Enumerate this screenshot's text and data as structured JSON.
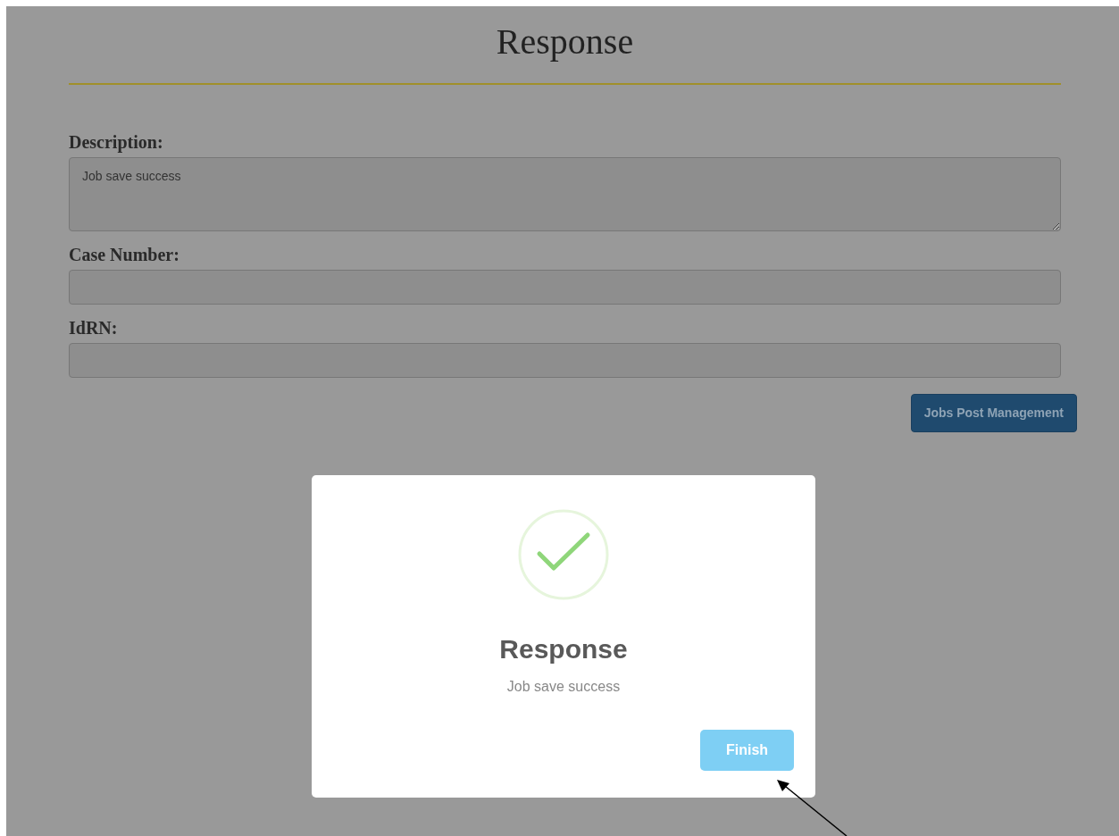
{
  "page": {
    "title": "Response"
  },
  "fields": [
    {
      "label": "Description:",
      "kind": "textarea",
      "value": "Job save success"
    },
    {
      "label": "Case Number:",
      "kind": "input"
    },
    {
      "label": "IdRN:",
      "kind": "input"
    }
  ],
  "action_button": "Jobs Post Management",
  "modal": {
    "title": "Response",
    "message": "Job save success",
    "button": "Finish"
  }
}
